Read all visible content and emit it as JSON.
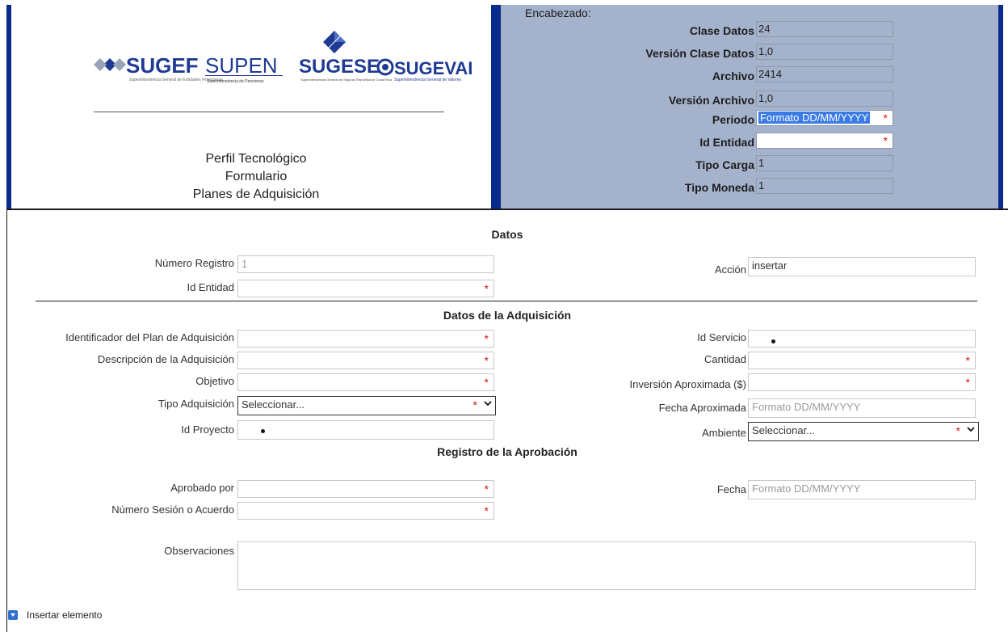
{
  "logos": [
    "SUGEF",
    "SUPEN",
    "SUGESE",
    "SUGEVAL"
  ],
  "logo_subtitles": {
    "sugef": "Superintendencia General de Entidades Financieras",
    "supen": "Superintendencia de Pensiones",
    "sugese": "Superintendencia General de Seguros República de Costa Rica",
    "sugeval": "Superintendencia General de Valores"
  },
  "title": {
    "line1": "Perfil Tecnológico",
    "line2": "Formulario",
    "line3": "Planes de Adquisición"
  },
  "header": {
    "heading": "Encabezado:",
    "clase_datos": {
      "label": "Clase Datos",
      "value": "24"
    },
    "version_clase": {
      "label": "Versión Clase Datos",
      "value": "1,0"
    },
    "archivo": {
      "label": "Archivo",
      "value": "2414"
    },
    "version_archivo": {
      "label": "Versión Archivo",
      "value": "1,0"
    },
    "periodo": {
      "label": "Periodo",
      "placeholder": "Formato DD/MM/YYYY"
    },
    "id_entidad": {
      "label": "Id Entidad",
      "value": ""
    },
    "tipo_carga": {
      "label": "Tipo Carga",
      "value": "1"
    },
    "tipo_moneda": {
      "label": "Tipo Moneda",
      "value": "1"
    }
  },
  "datos": {
    "title": "Datos",
    "numero_registro": {
      "label": "Número Registro",
      "value": "1"
    },
    "id_entidad": {
      "label": "Id Entidad",
      "value": ""
    },
    "accion": {
      "label": "Acción",
      "value": "insertar"
    }
  },
  "adquisicion": {
    "title": "Datos de la Adquisición",
    "identificador": {
      "label": "Identificador del Plan de Adquisición"
    },
    "descripcion": {
      "label": "Descripción de la Adquisición"
    },
    "objetivo": {
      "label": "Objetivo"
    },
    "tipo": {
      "label": "Tipo Adquisición",
      "value": "Seleccionar..."
    },
    "id_proyecto": {
      "label": "Id Proyecto"
    },
    "id_servicio": {
      "label": "Id Servicio"
    },
    "cantidad": {
      "label": "Cantidad"
    },
    "inversion": {
      "label": "Inversión Aproximada ($)"
    },
    "fecha_aprox": {
      "label": "Fecha Aproximada",
      "placeholder": "Formato DD/MM/YYYY"
    },
    "ambiente": {
      "label": "Ambiente",
      "value": "Seleccionar..."
    }
  },
  "aprobacion": {
    "title": "Registro de la Aprobación",
    "aprobado_por": {
      "label": "Aprobado por"
    },
    "numero_sesion": {
      "label": "Número Sesión o Acuerdo"
    },
    "fecha": {
      "label": "Fecha",
      "placeholder": "Formato DD/MM/YYYY"
    },
    "observaciones": {
      "label": "Observaciones"
    }
  },
  "insert_element": {
    "label": "Insertar elemento"
  },
  "required_mark": "*",
  "colors": {
    "frame_blue": "#0a2a8c",
    "header_bg": "#a4b2cc",
    "required": "#d11111",
    "logo_blue": "#1f3a93"
  }
}
